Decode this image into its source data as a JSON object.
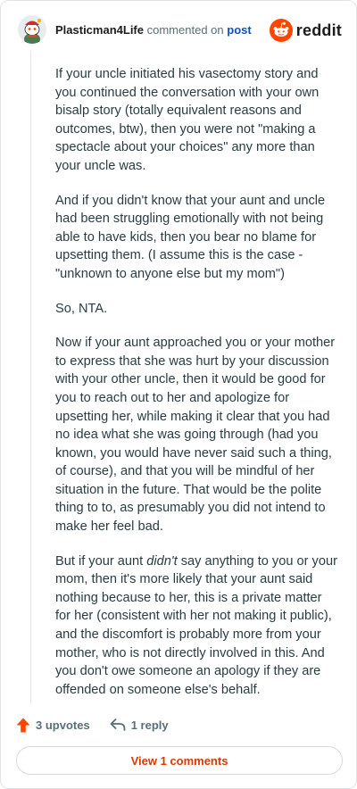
{
  "header": {
    "author": "Plasticman4Life",
    "commented_on": "commented on",
    "post_link": "post",
    "brand": "reddit"
  },
  "comment": {
    "p1": "If your uncle initiated his vasectomy story and you continued the conversation with your own bisalp story (totally equivalent reasons and outcomes, btw), then you were not \"making a spectacle about your choices\" any more than your uncle was.",
    "p2": "And if you didn't know that your aunt and uncle had been struggling emotionally with not being able to have kids, then you bear no blame for upsetting them. (I assume this is the case - \"unknown to anyone else but my mom\")",
    "p3": "So, NTA.",
    "p4": "Now if your aunt approached you or your mother to express that she was hurt by your discussion with your other uncle, then it would be good for you to reach out to her and apologize for upsetting her, while making it clear that you had no idea what she was going through (had you known, you would have never said such a thing, of course), and that you will be mindful of her situation in the future. That would be the polite thing to to, as presumably you did not intend to make her feel bad.",
    "p5_start": "But if your aunt ",
    "p5_emph": "didn't",
    "p5_end": " say anything to you or your mom, then it's more likely that your aunt said nothing because to her, this is a private matter for her (consistent with her not making it public), and the discomfort is probably more from your mother, who is not directly involved in this. And you don't owe someone an apology if they are offended on someone else's behalf."
  },
  "actions": {
    "upvotes": "3 upvotes",
    "reply": "1 reply",
    "view_comments": "View 1 comments"
  },
  "colors": {
    "upvote": "#ff4500",
    "link": "#0a52c6",
    "view_button_text": "#d93900"
  },
  "icons": {
    "avatar": "snoo-avatar",
    "brand": "reddit-logo-icon",
    "upvote": "upvote-arrow-icon",
    "reply": "reply-arrow-icon"
  }
}
